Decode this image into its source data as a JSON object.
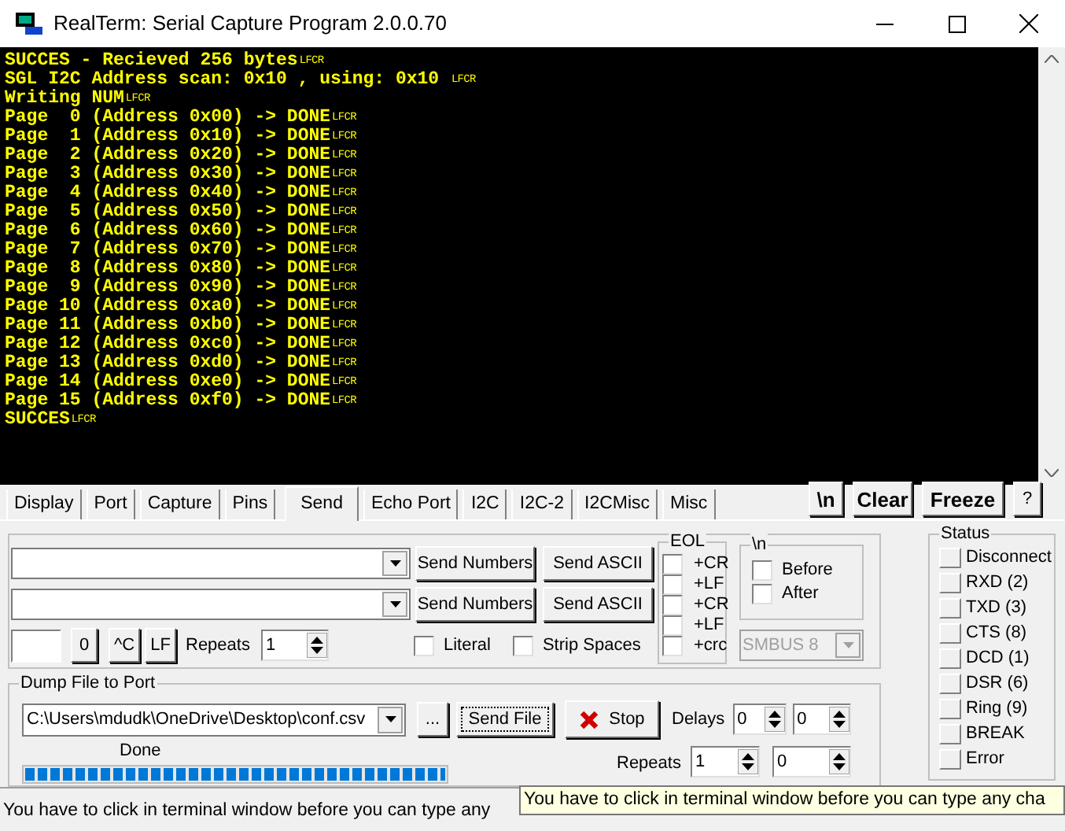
{
  "window": {
    "title": "RealTerm: Serial Capture Program 2.0.0.70"
  },
  "terminal": {
    "lines": [
      {
        "text": "SUCCES - Recieved 256 bytes",
        "end": "LFCR"
      },
      {
        "text": "SGL I2C Address scan: 0x10 , using: 0x10 ",
        "end": "LFCR"
      },
      {
        "text": "Writing NUM",
        "end": "LFCR"
      },
      {
        "text": "Page  0 (Address 0x00) -> DONE",
        "end": "LFCR"
      },
      {
        "text": "Page  1 (Address 0x10) -> DONE",
        "end": "LFCR"
      },
      {
        "text": "Page  2 (Address 0x20) -> DONE",
        "end": "LFCR"
      },
      {
        "text": "Page  3 (Address 0x30) -> DONE",
        "end": "LFCR"
      },
      {
        "text": "Page  4 (Address 0x40) -> DONE",
        "end": "LFCR"
      },
      {
        "text": "Page  5 (Address 0x50) -> DONE",
        "end": "LFCR"
      },
      {
        "text": "Page  6 (Address 0x60) -> DONE",
        "end": "LFCR"
      },
      {
        "text": "Page  7 (Address 0x70) -> DONE",
        "end": "LFCR"
      },
      {
        "text": "Page  8 (Address 0x80) -> DONE",
        "end": "LFCR"
      },
      {
        "text": "Page  9 (Address 0x90) -> DONE",
        "end": "LFCR"
      },
      {
        "text": "Page 10 (Address 0xa0) -> DONE",
        "end": "LFCR"
      },
      {
        "text": "Page 11 (Address 0xb0) -> DONE",
        "end": "LFCR"
      },
      {
        "text": "Page 12 (Address 0xc0) -> DONE",
        "end": "LFCR"
      },
      {
        "text": "Page 13 (Address 0xd0) -> DONE",
        "end": "LFCR"
      },
      {
        "text": "Page 14 (Address 0xe0) -> DONE",
        "end": "LFCR"
      },
      {
        "text": "Page 15 (Address 0xf0) -> DONE",
        "end": "LFCR"
      },
      {
        "text": "SUCCES",
        "end": "LFCR"
      }
    ]
  },
  "tabs": [
    {
      "label": "Display",
      "selected": false
    },
    {
      "label": "Port",
      "selected": false
    },
    {
      "label": "Capture",
      "selected": false
    },
    {
      "label": "Pins",
      "selected": false
    },
    {
      "label": "Send",
      "selected": true
    },
    {
      "label": "Echo Port",
      "selected": false
    },
    {
      "label": "I2C",
      "selected": false
    },
    {
      "label": "I2C-2",
      "selected": false
    },
    {
      "label": "I2CMisc",
      "selected": false
    },
    {
      "label": "Misc",
      "selected": false
    }
  ],
  "toolbar_buttons": [
    "\\n",
    "Clear",
    "Freeze",
    "?"
  ],
  "send_rows": [
    {
      "numbers_button": "Send Numbers",
      "ascii_button": "Send ASCII"
    },
    {
      "numbers_button": "Send Numbers",
      "ascii_button": "Send ASCII"
    }
  ],
  "eol": {
    "label": "EOL",
    "items": [
      {
        "label": "+CR",
        "checked": false
      },
      {
        "label": "+LF",
        "checked": false
      },
      {
        "label": "+CR",
        "checked": false
      },
      {
        "label": "+LF",
        "checked": false
      },
      {
        "label": "+crc",
        "checked": false
      }
    ]
  },
  "newline": {
    "label": "\\n",
    "items": [
      {
        "label": "Before",
        "checked": false
      },
      {
        "label": "After",
        "checked": false
      }
    ]
  },
  "smbus": {
    "value": "SMBUS 8",
    "disabled": true
  },
  "char_buttons": [
    "0",
    "^C",
    "LF"
  ],
  "repeats": {
    "label": "Repeats",
    "value": "1"
  },
  "options": [
    {
      "label": "Literal",
      "checked": false
    },
    {
      "label": "Strip Spaces",
      "checked": false
    }
  ],
  "dump": {
    "label": "Dump File to Port",
    "path": "C:\\Users\\mdudk\\OneDrive\\Desktop\\conf.csv",
    "browse": "...",
    "send_file": "Send File",
    "stop": "Stop",
    "delays_label": "Delays",
    "delays": [
      "0",
      "0"
    ],
    "progress_label": "Done",
    "level": 1,
    "repeats_label": "Repeats",
    "repeats": [
      "1",
      "0"
    ]
  },
  "status": {
    "label": "Status",
    "items": [
      {
        "label": "Disconnect",
        "on": false
      },
      {
        "label": "RXD (2)",
        "on": false
      },
      {
        "label": "TXD (3)",
        "on": false
      },
      {
        "label": "CTS (8)",
        "on": false
      },
      {
        "label": "DCD (1)",
        "on": false
      },
      {
        "label": "DSR (6)",
        "on": false
      },
      {
        "label": "Ring (9)",
        "on": false
      },
      {
        "label": "BREAK",
        "on": false
      },
      {
        "label": "Error",
        "on": false
      }
    ]
  },
  "status_bar": {
    "message": "You have to click in terminal window before you can type any"
  },
  "tooltip": {
    "text": "You have to click in terminal window before you can type any cha"
  }
}
